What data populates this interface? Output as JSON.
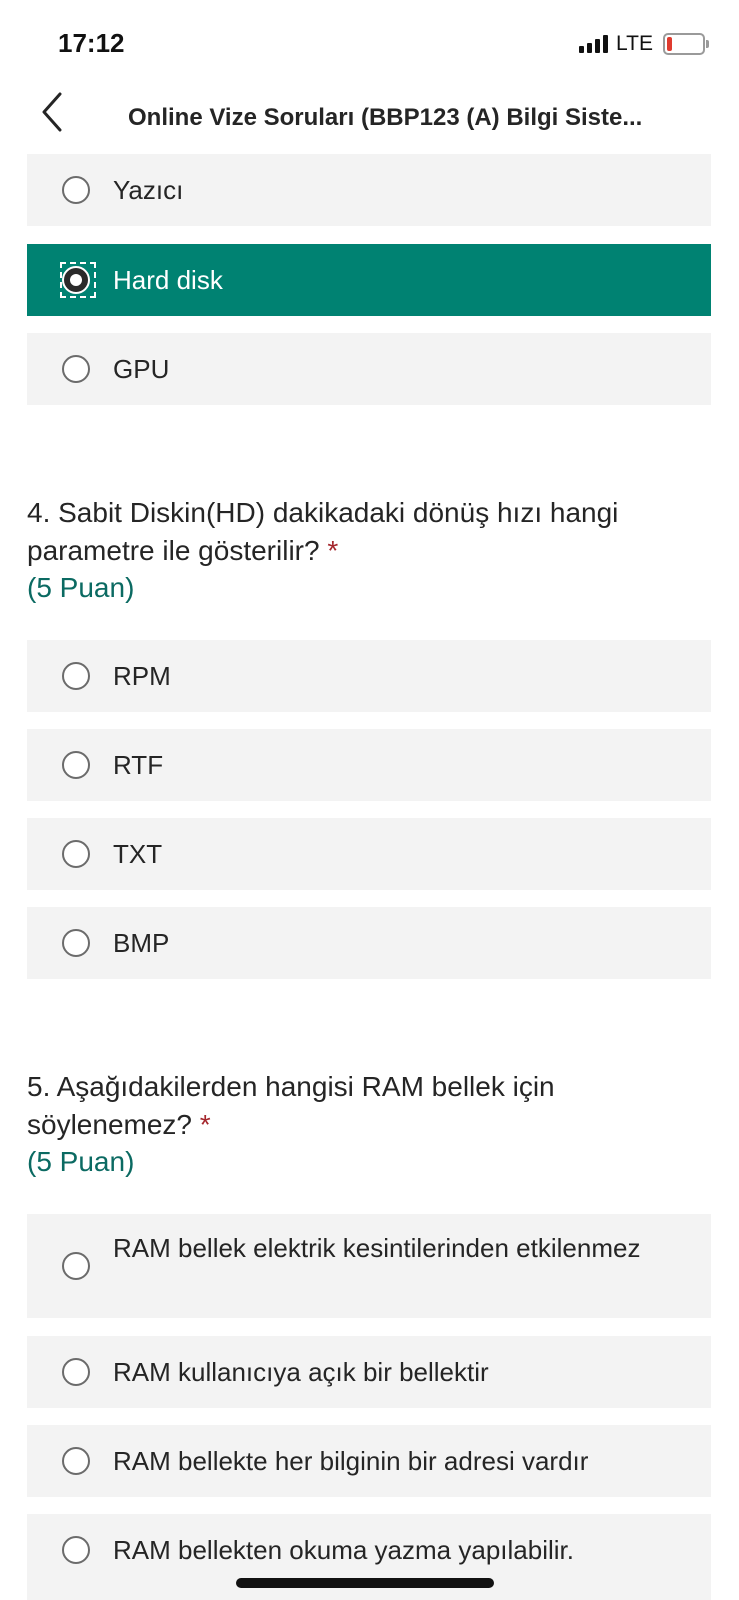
{
  "status_bar": {
    "time": "17:12",
    "network": "LTE",
    "icons": [
      "signal-icon",
      "battery-low-icon"
    ]
  },
  "nav": {
    "back_icon": "chevron-left-icon",
    "title": "Online Vize Soruları (BBP123 (A) Bilgi Siste..."
  },
  "prev_question": {
    "options": [
      {
        "label": "Yazıcı",
        "selected": false
      },
      {
        "label": "Hard disk",
        "selected": true
      },
      {
        "label": "GPU",
        "selected": false
      }
    ]
  },
  "question4": {
    "text": "4. Sabit Diskin(HD) dakikadaki dönüş hızı hangi parametre ile gösterilir?",
    "required": "*",
    "points": "(5 Puan)",
    "options": [
      {
        "label": "RPM",
        "selected": false
      },
      {
        "label": "RTF",
        "selected": false
      },
      {
        "label": "TXT",
        "selected": false
      },
      {
        "label": "BMP",
        "selected": false
      }
    ]
  },
  "question5": {
    "text": "5. Aşağıdakilerden hangisi RAM bellek için söylenemez?",
    "required": "*",
    "points": "(5 Puan)",
    "options": [
      {
        "label": "RAM bellek elektrik kesintilerinden etkilenmez",
        "selected": false
      },
      {
        "label": "RAM kullanıcıya açık bir bellektir",
        "selected": false
      },
      {
        "label": "RAM bellekte her bilginin bir adresi vardır",
        "selected": false
      },
      {
        "label": "RAM bellekten okuma yazma yapılabilir.",
        "selected": false
      }
    ]
  },
  "colors": {
    "selected_option": "#008272",
    "option_background": "#f3f3f3",
    "points_text": "#0b6a62",
    "required_star": "#a4262c"
  }
}
